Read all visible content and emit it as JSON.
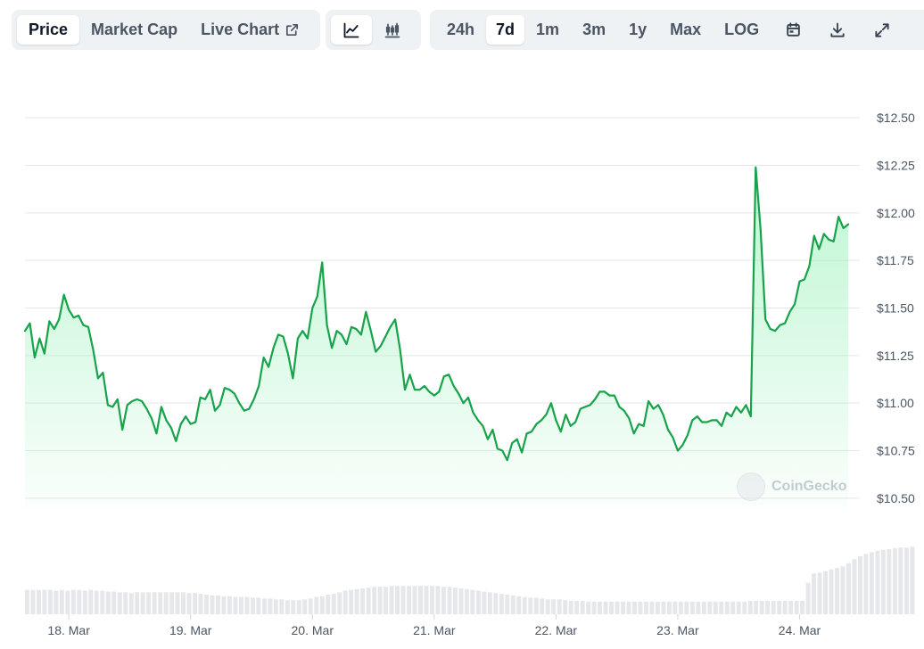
{
  "toolbar": {
    "metric_tabs": [
      {
        "label": "Price",
        "active": true
      },
      {
        "label": "Market Cap",
        "active": false
      },
      {
        "label": "Live Chart",
        "active": false
      }
    ],
    "view_buttons": [
      {
        "icon": "line-chart-icon",
        "active": true
      },
      {
        "icon": "candlestick-chart-icon",
        "active": false
      }
    ],
    "range_tabs": [
      {
        "label": "24h",
        "active": false
      },
      {
        "label": "7d",
        "active": true
      },
      {
        "label": "1m",
        "active": false
      },
      {
        "label": "3m",
        "active": false
      },
      {
        "label": "1y",
        "active": false
      },
      {
        "label": "Max",
        "active": false
      },
      {
        "label": "LOG",
        "active": false
      }
    ],
    "action_icons": [
      "calendar-icon",
      "download-icon",
      "expand-icon"
    ]
  },
  "watermark": {
    "text": "CoinGecko"
  },
  "colors": {
    "line": "#16a34a",
    "fill_top": "#86efac",
    "grid": "#e5e7eb",
    "volume": "#e5e7eb",
    "axis_text": "#4b5563"
  },
  "chart_data": {
    "type": "area",
    "title": "",
    "xlabel": "",
    "ylabel": "",
    "x_ticks": [
      "18. Mar",
      "19. Mar",
      "20. Mar",
      "21. Mar",
      "22. Mar",
      "23. Mar",
      "24. Mar"
    ],
    "x_range": [
      17.64,
      24.48
    ],
    "ylim": [
      10.45,
      12.55
    ],
    "y_ticks": [
      12.5,
      12.25,
      12.0,
      11.75,
      11.5,
      11.25,
      11.0,
      10.75,
      10.5
    ],
    "y_tick_labels": [
      "$12.50",
      "$12.25",
      "$12.00",
      "$11.75",
      "$11.50",
      "$11.25",
      "$11.00",
      "$10.75",
      "$10.50"
    ],
    "grid": true,
    "series": [
      {
        "values": [
          [
            17.64,
            11.38
          ],
          [
            17.68,
            11.42
          ],
          [
            17.72,
            11.24
          ],
          [
            17.76,
            11.34
          ],
          [
            17.8,
            11.26
          ],
          [
            17.84,
            11.43
          ],
          [
            17.88,
            11.39
          ],
          [
            17.92,
            11.44
          ],
          [
            17.96,
            11.57
          ],
          [
            18.0,
            11.49
          ],
          [
            18.04,
            11.45
          ],
          [
            18.08,
            11.46
          ],
          [
            18.12,
            11.41
          ],
          [
            18.16,
            11.4
          ],
          [
            18.2,
            11.28
          ],
          [
            18.24,
            11.13
          ],
          [
            18.28,
            11.16
          ],
          [
            18.32,
            10.99
          ],
          [
            18.36,
            10.98
          ],
          [
            18.4,
            11.02
          ],
          [
            18.44,
            10.86
          ],
          [
            18.48,
            10.99
          ],
          [
            18.52,
            11.01
          ],
          [
            18.56,
            11.02
          ],
          [
            18.6,
            11.01
          ],
          [
            18.64,
            10.97
          ],
          [
            18.68,
            10.92
          ],
          [
            18.72,
            10.84
          ],
          [
            18.76,
            10.98
          ],
          [
            18.8,
            10.91
          ],
          [
            18.84,
            10.87
          ],
          [
            18.88,
            10.8
          ],
          [
            18.92,
            10.89
          ],
          [
            18.96,
            10.93
          ],
          [
            19.0,
            10.89
          ],
          [
            19.04,
            10.9
          ],
          [
            19.08,
            11.03
          ],
          [
            19.12,
            11.02
          ],
          [
            19.16,
            11.07
          ],
          [
            19.2,
            10.96
          ],
          [
            19.24,
            10.99
          ],
          [
            19.28,
            11.08
          ],
          [
            19.32,
            11.07
          ],
          [
            19.36,
            11.05
          ],
          [
            19.4,
            11.0
          ],
          [
            19.44,
            10.96
          ],
          [
            19.48,
            10.97
          ],
          [
            19.52,
            11.02
          ],
          [
            19.56,
            11.09
          ],
          [
            19.6,
            11.24
          ],
          [
            19.64,
            11.19
          ],
          [
            19.68,
            11.29
          ],
          [
            19.72,
            11.36
          ],
          [
            19.76,
            11.35
          ],
          [
            19.8,
            11.26
          ],
          [
            19.84,
            11.13
          ],
          [
            19.88,
            11.34
          ],
          [
            19.92,
            11.38
          ],
          [
            19.96,
            11.34
          ],
          [
            20.0,
            11.5
          ],
          [
            20.04,
            11.56
          ],
          [
            20.08,
            11.74
          ],
          [
            20.12,
            11.41
          ],
          [
            20.16,
            11.29
          ],
          [
            20.2,
            11.38
          ],
          [
            20.24,
            11.36
          ],
          [
            20.28,
            11.31
          ],
          [
            20.32,
            11.4
          ],
          [
            20.36,
            11.39
          ],
          [
            20.4,
            11.36
          ],
          [
            20.44,
            11.48
          ],
          [
            20.48,
            11.38
          ],
          [
            20.52,
            11.27
          ],
          [
            20.56,
            11.3
          ],
          [
            20.6,
            11.35
          ],
          [
            20.64,
            11.4
          ],
          [
            20.68,
            11.44
          ],
          [
            20.72,
            11.28
          ],
          [
            20.76,
            11.07
          ],
          [
            20.8,
            11.15
          ],
          [
            20.84,
            11.07
          ],
          [
            20.88,
            11.07
          ],
          [
            20.92,
            11.09
          ],
          [
            20.96,
            11.06
          ],
          [
            21.0,
            11.04
          ],
          [
            21.04,
            11.06
          ],
          [
            21.08,
            11.14
          ],
          [
            21.12,
            11.15
          ],
          [
            21.16,
            11.09
          ],
          [
            21.2,
            11.05
          ],
          [
            21.24,
            11.0
          ],
          [
            21.28,
            11.03
          ],
          [
            21.32,
            10.95
          ],
          [
            21.36,
            10.91
          ],
          [
            21.4,
            10.88
          ],
          [
            21.44,
            10.81
          ],
          [
            21.48,
            10.86
          ],
          [
            21.52,
            10.76
          ],
          [
            21.56,
            10.75
          ],
          [
            21.6,
            10.7
          ],
          [
            21.64,
            10.79
          ],
          [
            21.68,
            10.81
          ],
          [
            21.72,
            10.74
          ],
          [
            21.76,
            10.84
          ],
          [
            21.8,
            10.85
          ],
          [
            21.84,
            10.89
          ],
          [
            21.88,
            10.91
          ],
          [
            21.92,
            10.94
          ],
          [
            21.96,
            11.0
          ],
          [
            22.0,
            10.91
          ],
          [
            22.04,
            10.85
          ],
          [
            22.08,
            10.94
          ],
          [
            22.12,
            10.88
          ],
          [
            22.16,
            10.9
          ],
          [
            22.2,
            10.97
          ],
          [
            22.24,
            10.98
          ],
          [
            22.28,
            10.99
          ],
          [
            22.32,
            11.02
          ],
          [
            22.36,
            11.06
          ],
          [
            22.4,
            11.06
          ],
          [
            22.44,
            11.04
          ],
          [
            22.48,
            11.04
          ],
          [
            22.52,
            10.98
          ],
          [
            22.56,
            10.96
          ],
          [
            22.6,
            10.92
          ],
          [
            22.64,
            10.84
          ],
          [
            22.68,
            10.89
          ],
          [
            22.72,
            10.88
          ],
          [
            22.76,
            11.01
          ],
          [
            22.8,
            10.97
          ],
          [
            22.84,
            10.99
          ],
          [
            22.88,
            10.94
          ],
          [
            22.92,
            10.86
          ],
          [
            22.96,
            10.82
          ],
          [
            23.0,
            10.75
          ],
          [
            23.04,
            10.78
          ],
          [
            23.08,
            10.83
          ],
          [
            23.12,
            10.91
          ],
          [
            23.16,
            10.93
          ],
          [
            23.2,
            10.9
          ],
          [
            23.24,
            10.9
          ],
          [
            23.28,
            10.91
          ],
          [
            23.32,
            10.91
          ],
          [
            23.36,
            10.88
          ],
          [
            23.4,
            10.95
          ],
          [
            23.44,
            10.93
          ],
          [
            23.48,
            10.98
          ],
          [
            23.52,
            10.95
          ],
          [
            23.56,
            10.99
          ],
          [
            23.6,
            10.93
          ],
          [
            23.64,
            12.24
          ],
          [
            23.68,
            11.91
          ],
          [
            23.72,
            11.44
          ],
          [
            23.76,
            11.39
          ],
          [
            23.8,
            11.38
          ],
          [
            23.84,
            11.41
          ],
          [
            23.88,
            11.42
          ],
          [
            23.92,
            11.48
          ],
          [
            23.96,
            11.52
          ],
          [
            24.0,
            11.64
          ],
          [
            24.04,
            11.65
          ],
          [
            24.08,
            11.72
          ],
          [
            24.12,
            11.88
          ],
          [
            24.16,
            11.81
          ],
          [
            24.2,
            11.89
          ],
          [
            24.24,
            11.86
          ],
          [
            24.28,
            11.85
          ],
          [
            24.32,
            11.98
          ],
          [
            24.36,
            11.92
          ],
          [
            24.4,
            11.94
          ]
        ]
      }
    ],
    "volume": {
      "x_range": [
        17.64,
        24.48
      ],
      "x_start": 17.64,
      "x_step": 0.0475,
      "heights": [
        0.31,
        0.31,
        0.31,
        0.31,
        0.31,
        0.3,
        0.31,
        0.3,
        0.31,
        0.31,
        0.3,
        0.31,
        0.3,
        0.3,
        0.29,
        0.29,
        0.28,
        0.28,
        0.27,
        0.28,
        0.28,
        0.28,
        0.28,
        0.28,
        0.28,
        0.28,
        0.28,
        0.28,
        0.27,
        0.27,
        0.26,
        0.25,
        0.24,
        0.24,
        0.23,
        0.23,
        0.22,
        0.22,
        0.22,
        0.21,
        0.21,
        0.2,
        0.2,
        0.19,
        0.19,
        0.18,
        0.18,
        0.18,
        0.19,
        0.2,
        0.22,
        0.23,
        0.25,
        0.26,
        0.28,
        0.3,
        0.31,
        0.32,
        0.33,
        0.34,
        0.35,
        0.35,
        0.35,
        0.36,
        0.36,
        0.36,
        0.36,
        0.36,
        0.36,
        0.36,
        0.36,
        0.36,
        0.35,
        0.35,
        0.34,
        0.33,
        0.32,
        0.31,
        0.3,
        0.29,
        0.28,
        0.27,
        0.26,
        0.25,
        0.24,
        0.23,
        0.22,
        0.21,
        0.21,
        0.2,
        0.19,
        0.19,
        0.19,
        0.18,
        0.17,
        0.17,
        0.17,
        0.16,
        0.16,
        0.16,
        0.16,
        0.16,
        0.16,
        0.16,
        0.16,
        0.16,
        0.16,
        0.16,
        0.16,
        0.16,
        0.16,
        0.16,
        0.16,
        0.16,
        0.16,
        0.16,
        0.16,
        0.16,
        0.16,
        0.16,
        0.16,
        0.16,
        0.16,
        0.16,
        0.16,
        0.17,
        0.17,
        0.17,
        0.17,
        0.17,
        0.17,
        0.17,
        0.17,
        0.17,
        0.17,
        0.4,
        0.52,
        0.53,
        0.55,
        0.57,
        0.59,
        0.61,
        0.65,
        0.7,
        0.74,
        0.77,
        0.79,
        0.81,
        0.82,
        0.83,
        0.84,
        0.85,
        0.85,
        0.86
      ]
    }
  }
}
